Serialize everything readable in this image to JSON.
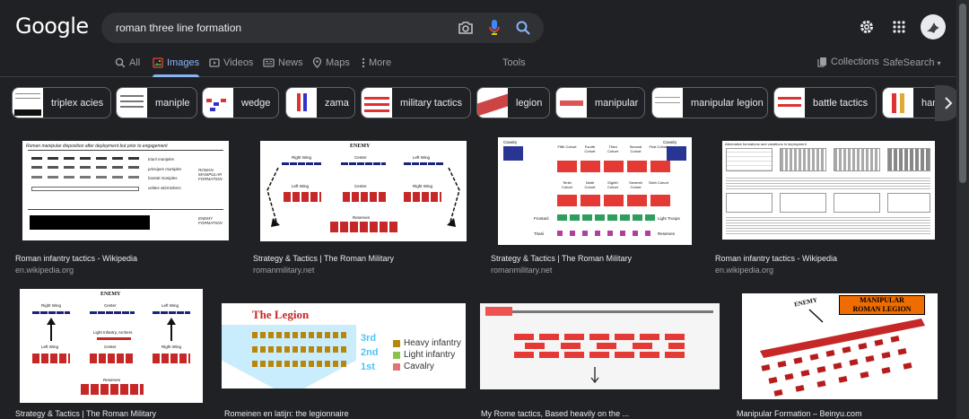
{
  "logo": "Google",
  "search": {
    "value": "roman three line formation"
  },
  "icons": {
    "camera": "camera-icon",
    "mic": "mic-icon",
    "search": "search-icon",
    "settings": "gear-icon",
    "apps": "apps-grid-icon"
  },
  "tabs": [
    {
      "label": "All",
      "icon": "search-icon"
    },
    {
      "label": "Images",
      "icon": "image-icon"
    },
    {
      "label": "Videos",
      "icon": "video-icon"
    },
    {
      "label": "News",
      "icon": "news-icon"
    },
    {
      "label": "Maps",
      "icon": "pin-icon"
    },
    {
      "label": "More",
      "icon": "dots-vertical-icon"
    }
  ],
  "tools": "Tools",
  "collections": "Collections",
  "safesearch": "SafeSearch",
  "chips": [
    "triplex acies",
    "maniple",
    "wedge",
    "zama",
    "military tactics",
    "legion",
    "manipular",
    "manipular legion",
    "battle tactics",
    "han"
  ],
  "results": [
    {
      "title": "Roman infantry tactics - Wikipedia",
      "source": "en.wikipedia.org",
      "img": {
        "heading": "Roman manipular disposition after deployment but prior to engagement",
        "lines": [
          "triarii maniples",
          "principes maniples",
          "hastati maniples",
          "velites skirmishers"
        ],
        "right1": "ROMAN MANIPULAR FORMATION",
        "right2": "ENEMY FORMATION"
      }
    },
    {
      "title": "Strategy & Tactics | The Roman Military",
      "source": "romanmilitary.net",
      "img": {
        "enemy": "ENEMY",
        "rw": "Right Wing",
        "c": "Center",
        "lw": "Left Wing",
        "reserves": "Reserves"
      }
    },
    {
      "title": "Strategy & Tactics | The Roman Military",
      "source": "romanmilitary.net",
      "img": {
        "cav": "Cavalry",
        "row1": [
          "Fifth Cohort",
          "Fourth Cohort",
          "Third Cohort",
          "Second Cohort",
          "First Cohort"
        ],
        "row2": [
          "Tenth Cohort",
          "Ninth Cohort",
          "Eighth Cohort",
          "Seventh Cohort",
          "Sixth Cohort"
        ],
        "front": "Frontarii",
        "light": "Light Troops",
        "triarii": "Triarii",
        "reserves": "Reserves"
      }
    },
    {
      "title": "Roman infantry tactics - Wikipedia",
      "source": "en.wikipedia.org",
      "img": {
        "heading": "Alternative formations and variations in deployment"
      }
    },
    {
      "title": "Strategy & Tactics | The Roman Military",
      "source": "",
      "img": {
        "enemy": "ENEMY",
        "rw": "Right Wing",
        "c": "Center",
        "lw": "Left Wing",
        "light": "Light Infantry, Archers",
        "reserves": "Reserves"
      }
    },
    {
      "title": "Romeinen en latijn: the legionnaire",
      "source": "",
      "img": {
        "heading": "The Legion",
        "ord": [
          "3rd",
          "2nd",
          "1st"
        ],
        "legend": [
          "Heavy infantry",
          "Light infantry",
          "Cavalry"
        ]
      }
    },
    {
      "title": "My Rome tactics, Based heavily on the ...",
      "source": "",
      "img": {}
    },
    {
      "title": "Manipular Formation – Beinyu.com",
      "source": "",
      "img": {
        "t1": "MANIPULAR",
        "t2": "ROMAN LEGION",
        "enemy": "ENEMY"
      }
    }
  ]
}
